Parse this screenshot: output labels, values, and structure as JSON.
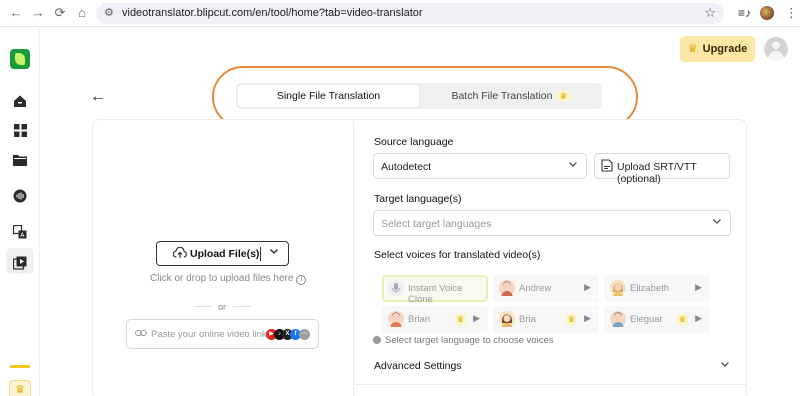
{
  "browser": {
    "url": "videotranslator.blipcut.com/en/tool/home?tab=video-translator",
    "back_glyph": "←",
    "forward_glyph": "→",
    "reload_glyph": "⟳",
    "home_glyph": "⌂",
    "star_glyph": "☆",
    "menu_glyph": "⋮",
    "tune_glyph": "⚙"
  },
  "sidebar": {
    "icons": [
      "home-icon",
      "dashboard-icon",
      "folder-icon",
      "audio-icon",
      "translate-icon",
      "media-icon"
    ],
    "crown_glyph": "♛"
  },
  "header": {
    "upgrade_label": "Upgrade",
    "crown_glyph": "♛",
    "back_glyph": "←"
  },
  "tabs": {
    "single": "Single File Translation",
    "batch": "Batch File Translation",
    "crown_glyph": "♛"
  },
  "upload": {
    "button_label": "Upload File(s)",
    "drop_hint": "Click or drop to upload files here",
    "or_text": "or",
    "paste_placeholder": "Paste your online video link",
    "platforms": [
      "YouTube",
      "TikTok",
      "X",
      "Facebook",
      "More"
    ]
  },
  "form": {
    "source_label": "Source language",
    "source_value": "Autodetect",
    "srt_label": "Upload SRT/VTT (optional)",
    "target_label": "Target language(s)",
    "target_placeholder": "Select target languages",
    "voices_label": "Select voices for translated video(s)",
    "voices": [
      {
        "name": "Instant Voice Clone",
        "premium": false
      },
      {
        "name": "Andrew",
        "premium": false
      },
      {
        "name": "Elizabeth",
        "premium": false
      },
      {
        "name": "Brian",
        "premium": true
      },
      {
        "name": "Bria",
        "premium": true
      },
      {
        "name": "Eleguar",
        "premium": true
      }
    ],
    "choose_hint": "Select target language to choose voices",
    "advanced_label": "Advanced Settings"
  },
  "colors": {
    "accent_orange": "#e88a3a",
    "upgrade_bg": "#fde7a6",
    "brand_green": "#1a9b3a"
  }
}
